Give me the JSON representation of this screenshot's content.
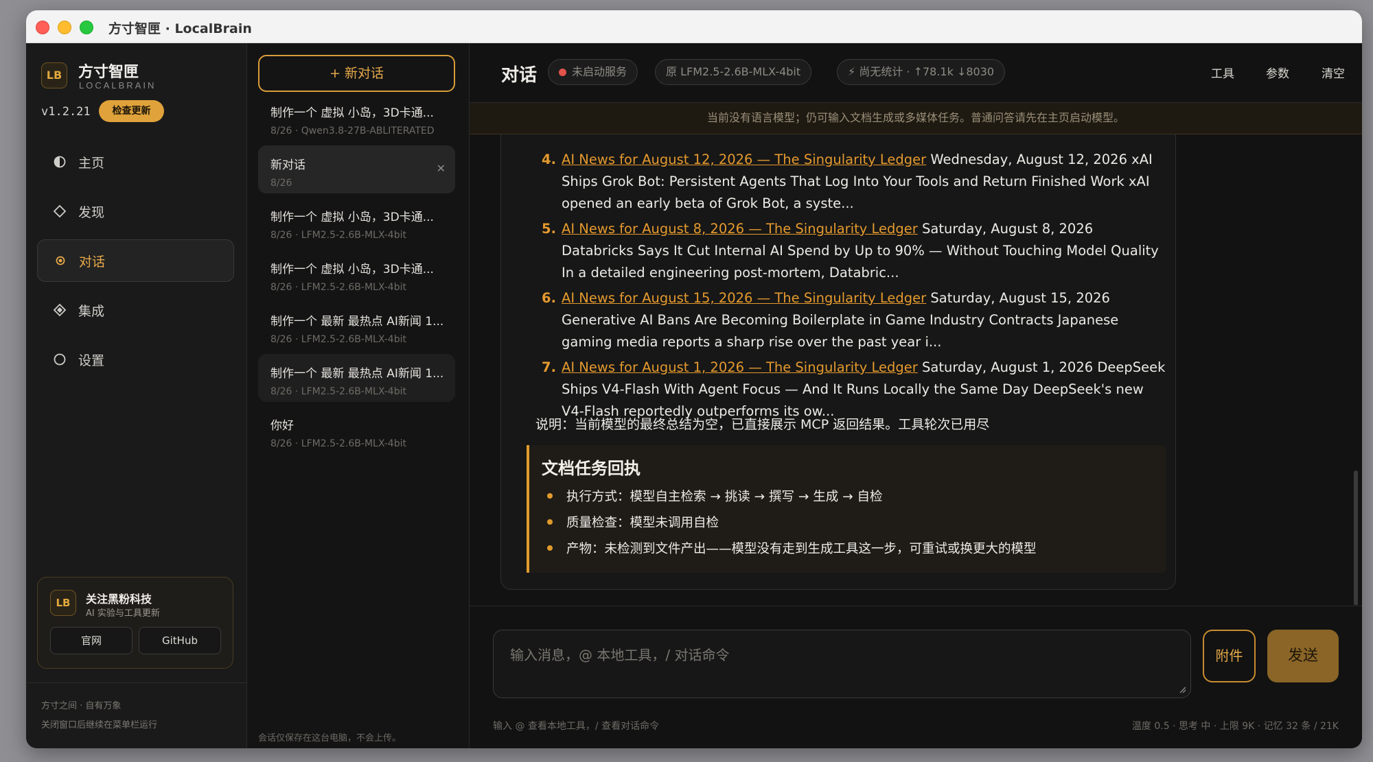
{
  "window": {
    "title": "方寸智匣 · LocalBrain"
  },
  "sidebar": {
    "logo": "LB",
    "brand_name": "方寸智匣",
    "brand_sub": "LOCALBRAIN",
    "version": "v1.2.21",
    "update_label": "检查更新",
    "items": [
      {
        "label": "主页",
        "icon": "home-icon"
      },
      {
        "label": "发现",
        "icon": "discover-icon"
      },
      {
        "label": "对话",
        "icon": "chat-icon",
        "active": true
      },
      {
        "label": "集成",
        "icon": "integration-icon"
      },
      {
        "label": "设置",
        "icon": "settings-icon"
      }
    ],
    "follow": {
      "logo": "LB",
      "title": "关注黑粉科技",
      "subtitle": "AI 实验与工具更新",
      "site_label": "官网",
      "github_label": "GitHub"
    },
    "footer_line1": "方寸之间 · 自有万象",
    "footer_line2": "关闭窗口后继续在菜单栏运行"
  },
  "conversations": {
    "new_label": "+ 新对话",
    "items": [
      {
        "title": "制作一个 虚拟 小岛，3D卡通...",
        "meta": "8/26 · Qwen3.8-27B-ABLITERATED"
      },
      {
        "title": "新对话",
        "meta": "8/26",
        "selected": true
      },
      {
        "title": "制作一个 虚拟 小岛，3D卡通...",
        "meta": "8/26 · LFM2.5-2.6B-MLX-4bit"
      },
      {
        "title": "制作一个 虚拟 小岛，3D卡通...",
        "meta": "8/26 · LFM2.5-2.6B-MLX-4bit"
      },
      {
        "title": "制作一个 最新 最热点 AI新闻 1...",
        "meta": "8/26 · LFM2.5-2.6B-MLX-4bit"
      },
      {
        "title": "制作一个 最新 最热点 AI新闻 1...",
        "meta": "8/26 · LFM2.5-2.6B-MLX-4bit"
      },
      {
        "title": "你好",
        "meta": "8/26 · LFM2.5-2.6B-MLX-4bit"
      }
    ],
    "footer": "会话仅保存在这台电脑，不会上传。"
  },
  "header": {
    "title": "对话",
    "status": "未启动服务",
    "model": "原 LFM2.5-2.6B-MLX-4bit",
    "stats": "⚡ 尚无统计 · ↑78.1k ↓8030",
    "tools_label": "工具",
    "params_label": "参数",
    "clear_label": "清空"
  },
  "banner": "当前没有语言模型；仍可输入文档生成或多媒体任务。普通问答请先在主页启动模型。",
  "messages": {
    "news": [
      {
        "num": "4.",
        "link": "AI News for August 12, 2026 — The Singularity Ledger",
        "text": " Wednesday, August 12, 2026 xAI Ships Grok Bot: Persistent Agents That Log Into Your Tools and Return Finished Work xAI opened an early beta of Grok Bot, a syste..."
      },
      {
        "num": "5.",
        "link": "AI News for August 8, 2026 — The Singularity Ledger",
        "text": " Saturday, August 8, 2026 Databricks Says It Cut Internal AI Spend by Up to 90% — Without Touching Model Quality In a detailed engineering post-mortem, Databric..."
      },
      {
        "num": "6.",
        "link": "AI News for August 15, 2026 — The Singularity Ledger",
        "text": " Saturday, August 15, 2026 Generative AI Bans Are Becoming Boilerplate in Game Industry Contracts Japanese gaming media reports a sharp rise over the past year i..."
      },
      {
        "num": "7.",
        "link": "AI News for August 1, 2026 — The Singularity Ledger",
        "text": " Saturday, August 1, 2026 DeepSeek Ships V4-Flash With Agent Focus — And It Runs Locally the Same Day DeepSeek's new V4-Flash reportedly outperforms its ow..."
      }
    ],
    "note": "说明：当前模型的最终总结为空，已直接展示 MCP 返回结果。工具轮次已用尽",
    "receipt": {
      "title": "文档任务回执",
      "items": [
        "执行方式：模型自主检索 → 挑读 → 撰写 → 生成 → 自检",
        "质量检查：模型未调用自检",
        "产物：未检测到文件产出——模型没有走到生成工具这一步，可重试或换更大的模型"
      ]
    }
  },
  "composer": {
    "placeholder": "输入消息，@ 本地工具，/ 对话命令",
    "attach_label": "附件",
    "send_label": "发送",
    "hint": "输入 @ 查看本地工具，/ 查看对话命令",
    "stats": "温度 0.5 · 思考 中 · 上限 9K · 记忆 32 条 / 21K"
  },
  "colors": {
    "accent": "#e59a2e",
    "background": "#121212",
    "status_red": "#e2534a"
  }
}
